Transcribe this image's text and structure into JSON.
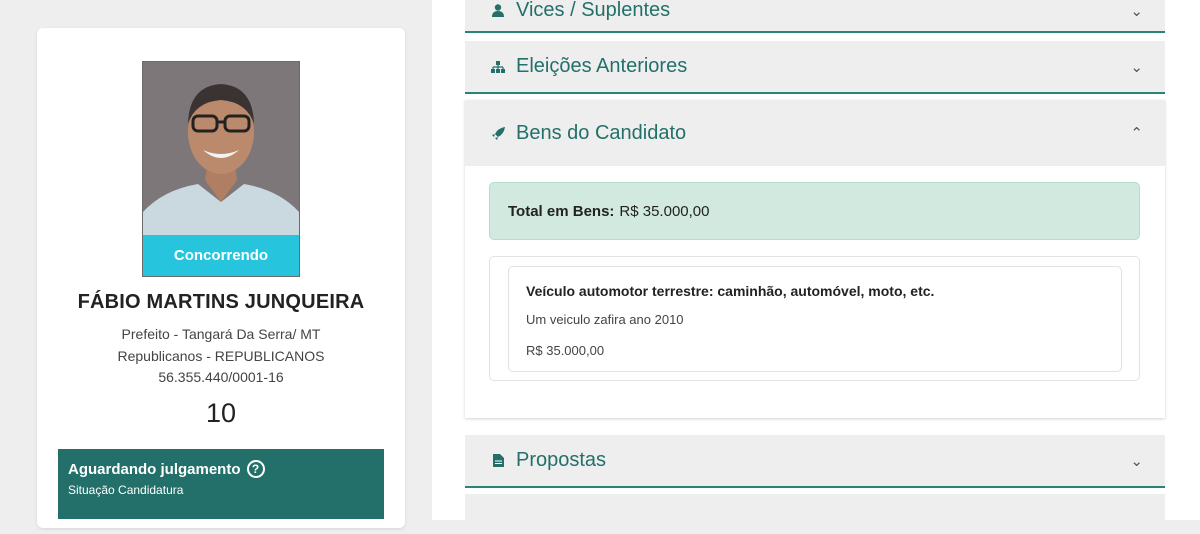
{
  "candidate": {
    "photo_badge": "Concorrendo",
    "name": "FÁBIO MARTINS JUNQUEIRA",
    "office_location": "Prefeito - Tangará Da Serra/ MT",
    "party": "Republicanos - REPUBLICANOS",
    "cnpj": "56.355.440/0001-16",
    "number": "10",
    "status_title": "Aguardando julgamento",
    "status_subtitle": "Situação Candidatura",
    "help_icon": "?"
  },
  "sections": {
    "vices": {
      "title": "Vices / Suplentes",
      "icon": "person-icon"
    },
    "previous_elections": {
      "title": "Eleições Anteriores",
      "icon": "sitemap-icon"
    },
    "assets": {
      "title": "Bens do Candidato",
      "icon": "rocket-icon",
      "total_label": "Total em Bens:",
      "total_value": "R$ 35.000,00",
      "items": [
        {
          "title": "Veículo automotor terrestre: caminhão, automóvel, moto, etc.",
          "description": "Um veiculo zafira ano 2010",
          "value": "R$ 35.000,00"
        }
      ]
    },
    "proposals": {
      "title": "Propostas",
      "icon": "file-icon"
    }
  },
  "colors": {
    "accent_teal": "#23706a",
    "badge_cyan": "#27c5dd",
    "total_bg": "#d2e9df",
    "page_bg": "#eeeeee"
  }
}
